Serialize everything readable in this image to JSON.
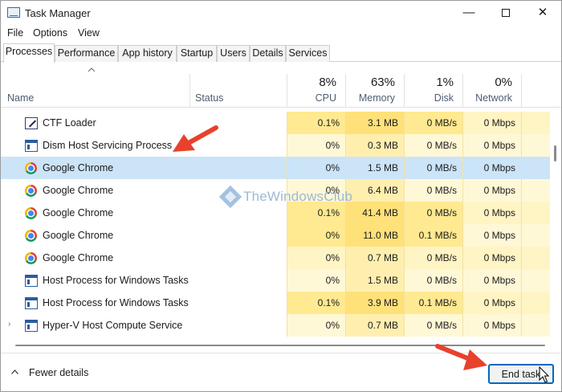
{
  "window": {
    "title": "Task Manager",
    "minimize_glyph": "—",
    "close_glyph": "✕"
  },
  "menu": [
    "File",
    "Options",
    "View"
  ],
  "tabs": [
    {
      "label": "Processes",
      "active": true
    },
    {
      "label": "Performance",
      "active": false
    },
    {
      "label": "App history",
      "active": false
    },
    {
      "label": "Startup",
      "active": false
    },
    {
      "label": "Users",
      "active": false
    },
    {
      "label": "Details",
      "active": false
    },
    {
      "label": "Services",
      "active": false
    }
  ],
  "header": {
    "name_label": "Name",
    "status_label": "Status",
    "cpu": {
      "percent": "8%",
      "label": "CPU"
    },
    "memory": {
      "percent": "63%",
      "label": "Memory"
    },
    "disk": {
      "percent": "1%",
      "label": "Disk"
    },
    "network": {
      "percent": "0%",
      "label": "Network"
    }
  },
  "processes": [
    {
      "name": "CTF Loader",
      "icon": "pen-icon",
      "cpu": "0.1%",
      "memory": "3.1 MB",
      "disk": "0 MB/s",
      "network": "0 Mbps",
      "selected": false,
      "expandable": false
    },
    {
      "name": "Dism Host Servicing Process",
      "icon": "window-icon",
      "cpu": "0%",
      "memory": "0.3 MB",
      "disk": "0 MB/s",
      "network": "0 Mbps",
      "selected": false,
      "expandable": false
    },
    {
      "name": "Google Chrome",
      "icon": "chrome-icon",
      "cpu": "0%",
      "memory": "1.5 MB",
      "disk": "0 MB/s",
      "network": "0 Mbps",
      "selected": true,
      "expandable": false
    },
    {
      "name": "Google Chrome",
      "icon": "chrome-icon",
      "cpu": "0%",
      "memory": "6.4 MB",
      "disk": "0 MB/s",
      "network": "0 Mbps",
      "selected": false,
      "expandable": false
    },
    {
      "name": "Google Chrome",
      "icon": "chrome-icon",
      "cpu": "0.1%",
      "memory": "41.4 MB",
      "disk": "0 MB/s",
      "network": "0 Mbps",
      "selected": false,
      "expandable": false
    },
    {
      "name": "Google Chrome",
      "icon": "chrome-icon",
      "cpu": "0%",
      "memory": "11.0 MB",
      "disk": "0.1 MB/s",
      "network": "0 Mbps",
      "selected": false,
      "expandable": false
    },
    {
      "name": "Google Chrome",
      "icon": "chrome-icon",
      "cpu": "0%",
      "memory": "0.7 MB",
      "disk": "0 MB/s",
      "network": "0 Mbps",
      "selected": false,
      "expandable": false
    },
    {
      "name": "Host Process for Windows Tasks",
      "icon": "window-icon",
      "cpu": "0%",
      "memory": "1.5 MB",
      "disk": "0 MB/s",
      "network": "0 Mbps",
      "selected": false,
      "expandable": false
    },
    {
      "name": "Host Process for Windows Tasks",
      "icon": "window-icon",
      "cpu": "0.1%",
      "memory": "3.9 MB",
      "disk": "0.1 MB/s",
      "network": "0 Mbps",
      "selected": false,
      "expandable": false
    },
    {
      "name": "Hyper-V Host Compute Service",
      "icon": "window-icon",
      "cpu": "0%",
      "memory": "0.7 MB",
      "disk": "0 MB/s",
      "network": "0 Mbps",
      "selected": false,
      "expandable": true
    }
  ],
  "footer": {
    "fewer_details": "Fewer details",
    "end_task": "End task"
  },
  "watermark": "TheWindowsClub",
  "colors": {
    "selection": "#cce4f7",
    "heat_low": "#fff4c4",
    "heat_mid": "#ffe991",
    "accent": "#0067c0",
    "arrow": "#e8412c"
  }
}
